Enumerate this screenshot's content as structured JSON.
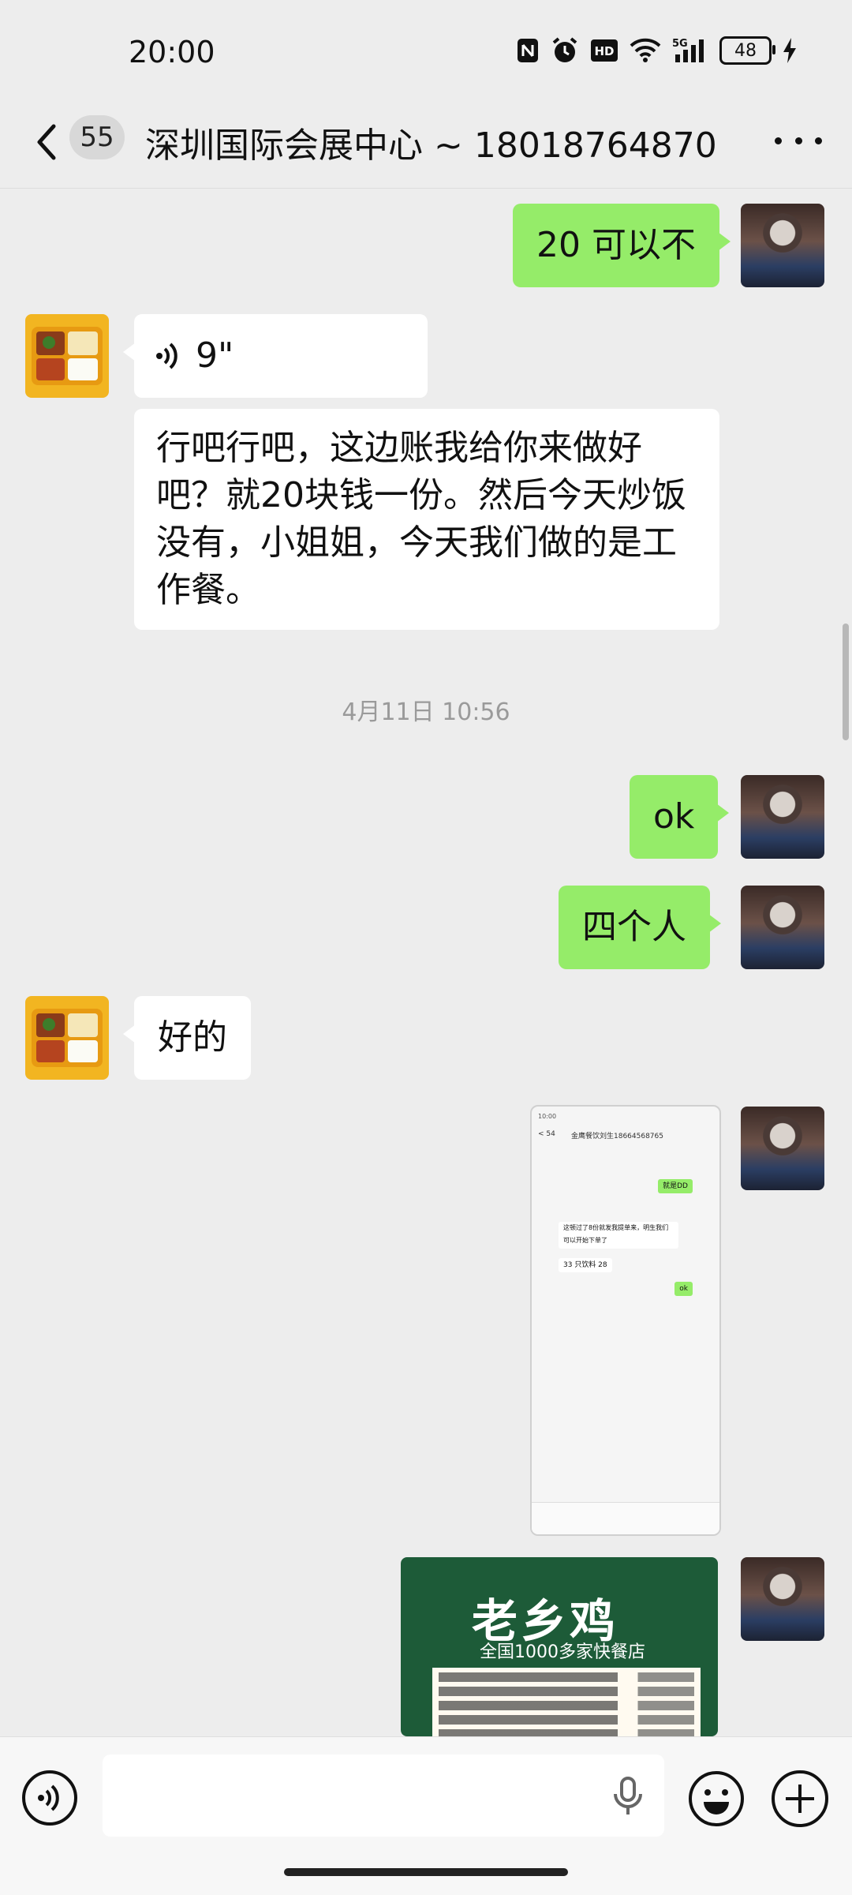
{
  "status": {
    "time": "20:00",
    "battery": "48",
    "network": "5G",
    "hd": "HD"
  },
  "header": {
    "unread_count": "55",
    "title": "深圳国际会展中心 ~ 18018764870"
  },
  "messages": {
    "m1": "20 可以不",
    "voice_duration": "9\"",
    "m3": "行吧行吧，这边账我给你来做好吧？就20块钱一份。然后今天炒饭没有，小姐姐，今天我们做的是工作餐。",
    "timestamp": "4月11日 10:56",
    "m4": "ok",
    "m5": "四个人",
    "m6": "好的"
  },
  "screenshot_image": {
    "time": "10:00",
    "unread": "< 54",
    "title": "金鹰餐饮刘生18664568765",
    "bubble1": "就是DD",
    "bubble2": "这顿过了8份就发我提单来，明生我们可以开始下单了",
    "bubble3": "33 只饮料 28",
    "bubble4": "ok"
  },
  "flyer_image": {
    "brand": "老乡鸡",
    "subtitle": "全国1000多家快餐店"
  },
  "colors": {
    "background": "#ededed",
    "sent_bubble": "#95ec69",
    "received_bubble": "#ffffff"
  }
}
